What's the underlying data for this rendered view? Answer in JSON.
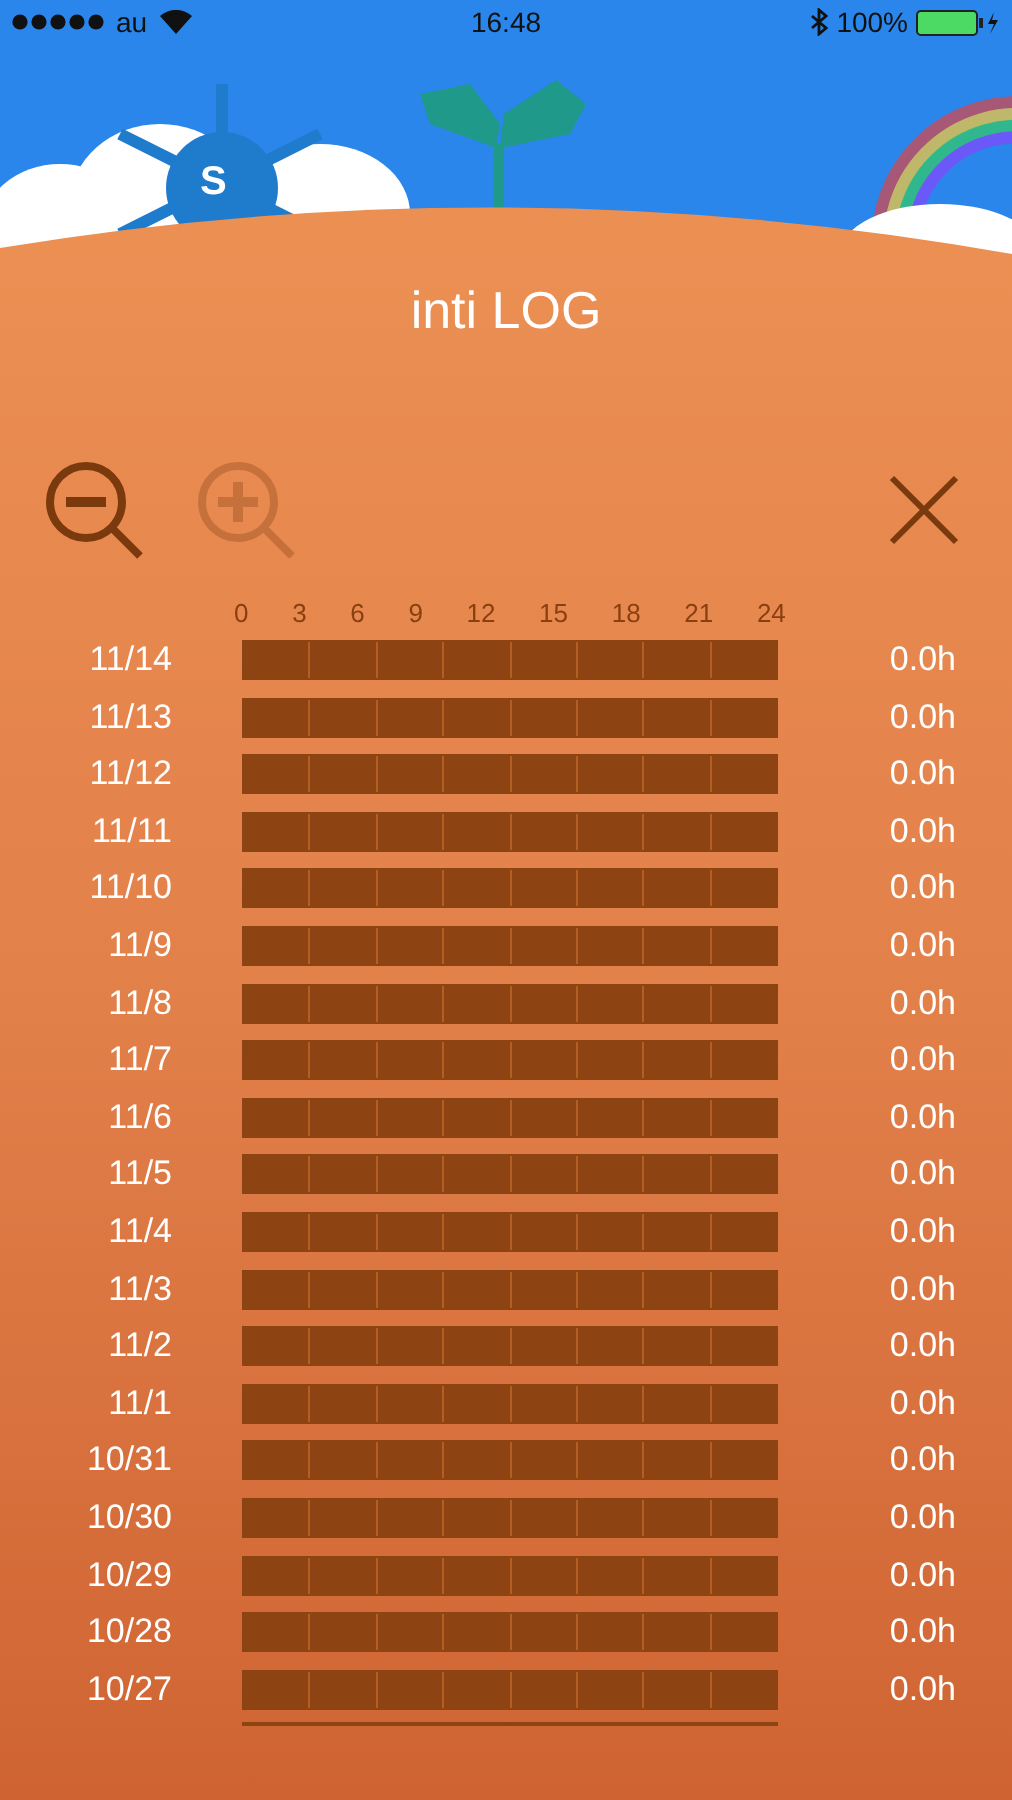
{
  "status_bar": {
    "carrier": "au",
    "time": "16:48",
    "battery": "100%"
  },
  "header": {
    "sun_label": "S",
    "title": "inti LOG"
  },
  "toolbar": {
    "zoom_out": {
      "disabled": false
    },
    "zoom_in": {
      "disabled": true
    }
  },
  "hour_ticks": [
    "0",
    "3",
    "6",
    "9",
    "12",
    "15",
    "18",
    "21",
    "24"
  ],
  "rows": [
    {
      "date": "11/14",
      "hours": "0.0h"
    },
    {
      "date": "11/13",
      "hours": "0.0h"
    },
    {
      "date": "11/12",
      "hours": "0.0h"
    },
    {
      "date": "11/11",
      "hours": "0.0h"
    },
    {
      "date": "11/10",
      "hours": "0.0h"
    },
    {
      "date": "11/9",
      "hours": "0.0h"
    },
    {
      "date": "11/8",
      "hours": "0.0h"
    },
    {
      "date": "11/7",
      "hours": "0.0h"
    },
    {
      "date": "11/6",
      "hours": "0.0h"
    },
    {
      "date": "11/5",
      "hours": "0.0h"
    },
    {
      "date": "11/4",
      "hours": "0.0h"
    },
    {
      "date": "11/3",
      "hours": "0.0h"
    },
    {
      "date": "11/2",
      "hours": "0.0h"
    },
    {
      "date": "11/1",
      "hours": "0.0h"
    },
    {
      "date": "10/31",
      "hours": "0.0h"
    },
    {
      "date": "10/30",
      "hours": "0.0h"
    },
    {
      "date": "10/29",
      "hours": "0.0h"
    },
    {
      "date": "10/28",
      "hours": "0.0h"
    },
    {
      "date": "10/27",
      "hours": "0.0h"
    }
  ]
}
